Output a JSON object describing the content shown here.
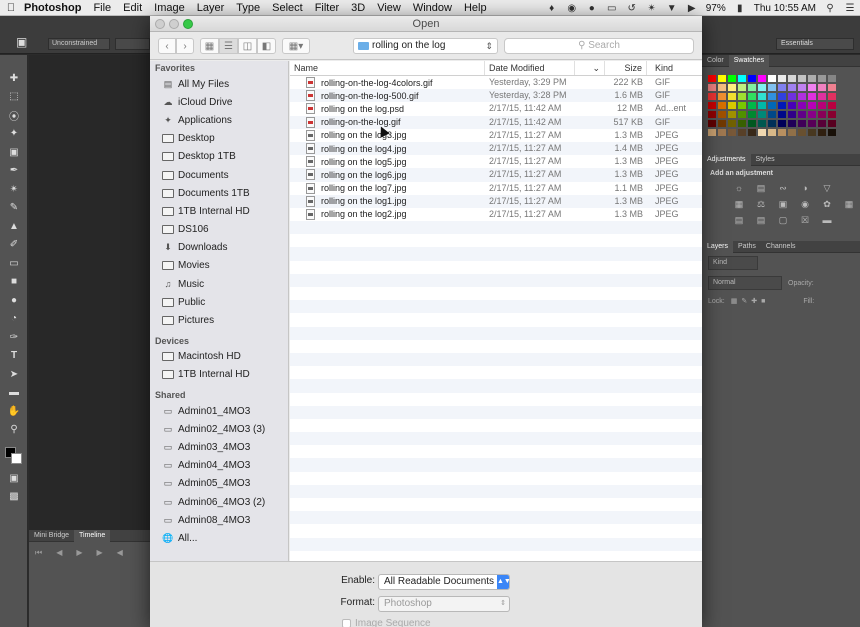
{
  "menubar": {
    "app_name": "Photoshop",
    "menus": [
      "File",
      "Edit",
      "Image",
      "Layer",
      "Type",
      "Select",
      "Filter",
      "3D",
      "View",
      "Window",
      "Help"
    ],
    "battery": "97%",
    "clock": "Thu 10:55 AM"
  },
  "photoshop": {
    "tool_preset": "Unconstrained",
    "workspace": "Essentials",
    "panel_tabs_top": [
      "Color",
      "Swatches"
    ],
    "panel_tabs_mid": [
      "Adjustments",
      "Styles"
    ],
    "adjustment_title": "Add an adjustment",
    "panel_tabs_layers": [
      "Layers",
      "Paths",
      "Channels"
    ],
    "layers_kind": "Kind",
    "layers_blend": "Normal",
    "layers_opacity_label": "Opacity:",
    "layers_lock_label": "Lock:",
    "layers_fill_label": "Fill:",
    "bottom_tabs": [
      "Mini Bridge",
      "Timeline"
    ],
    "swatch_colors": [
      "#ff0000",
      "#ffff00",
      "#00ff00",
      "#00ffff",
      "#0000ff",
      "#ff00ff",
      "#ffffff",
      "#ebebeb",
      "#d6d6d6",
      "#c2c2c2",
      "#adadad",
      "#999999",
      "#858585",
      "#f08080",
      "#f5c080",
      "#fff080",
      "#c0f080",
      "#80f0a0",
      "#80f0f0",
      "#80c0f0",
      "#8080f0",
      "#a080f0",
      "#c080f0",
      "#f080f0",
      "#f080c0",
      "#f08090",
      "#ee3333",
      "#f09030",
      "#f0e030",
      "#a0e030",
      "#30e060",
      "#30e0d0",
      "#3090e0",
      "#3040e0",
      "#7030e0",
      "#b030e0",
      "#e030e0",
      "#e030a0",
      "#e03060",
      "#c80000",
      "#d87000",
      "#d8c800",
      "#78c800",
      "#00b848",
      "#00b8a8",
      "#0068b8",
      "#0018b8",
      "#4800b8",
      "#8800b8",
      "#b800b8",
      "#b80078",
      "#b80040",
      "#900000",
      "#a05000",
      "#a09000",
      "#509000",
      "#008830",
      "#008878",
      "#004888",
      "#000888",
      "#300088",
      "#600088",
      "#880088",
      "#880058",
      "#880030",
      "#600000",
      "#703800",
      "#706000",
      "#386000",
      "#005820",
      "#005850",
      "#003058",
      "#000058",
      "#200058",
      "#400058",
      "#580058",
      "#580038",
      "#580020",
      "#c8a070",
      "#a07850",
      "#785838",
      "#584028",
      "#382818",
      "#f0d8b0",
      "#d8b888",
      "#b89060",
      "#907048",
      "#685030",
      "#483820",
      "#302010",
      "#181008"
    ]
  },
  "dialog": {
    "title": "Open",
    "current_folder": "rolling on the log",
    "search_placeholder": "Search",
    "sidebar": {
      "favorites_heading": "Favorites",
      "favorites": [
        {
          "label": "All My Files",
          "icon": "all-files"
        },
        {
          "label": "iCloud Drive",
          "icon": "cloud"
        },
        {
          "label": "Applications",
          "icon": "applications"
        },
        {
          "label": "Desktop",
          "icon": "folder"
        },
        {
          "label": "Desktop 1TB",
          "icon": "folder"
        },
        {
          "label": "Documents",
          "icon": "folder"
        },
        {
          "label": "Documents 1TB",
          "icon": "folder"
        },
        {
          "label": "1TB Internal HD",
          "icon": "folder"
        },
        {
          "label": "DS106",
          "icon": "folder"
        },
        {
          "label": "Downloads",
          "icon": "download"
        },
        {
          "label": "Movies",
          "icon": "folder"
        },
        {
          "label": "Music",
          "icon": "music"
        },
        {
          "label": "Public",
          "icon": "folder"
        },
        {
          "label": "Pictures",
          "icon": "folder"
        }
      ],
      "devices_heading": "Devices",
      "devices": [
        {
          "label": "Macintosh HD",
          "icon": "drive"
        },
        {
          "label": "1TB Internal HD",
          "icon": "drive"
        }
      ],
      "shared_heading": "Shared",
      "shared": [
        {
          "label": "Admin01_4MO3",
          "icon": "monitor"
        },
        {
          "label": "Admin02_4MO3 (3)",
          "icon": "monitor"
        },
        {
          "label": "Admin03_4MO3",
          "icon": "monitor"
        },
        {
          "label": "Admin04_4MO3",
          "icon": "monitor"
        },
        {
          "label": "Admin05_4MO3",
          "icon": "monitor"
        },
        {
          "label": "Admin06_4MO3 (2)",
          "icon": "monitor"
        },
        {
          "label": "Admin08_4MO3",
          "icon": "monitor"
        },
        {
          "label": "All...",
          "icon": "network"
        }
      ]
    },
    "columns": {
      "name": "Name",
      "date": "Date Modified",
      "size": "Size",
      "kind": "Kind"
    },
    "files": [
      {
        "name": "rolling-on-the-log-4colors.gif",
        "date": "Yesterday, 3:29 PM",
        "size": "222 KB",
        "kind": "GIF",
        "type": "img"
      },
      {
        "name": "rolling-on-the-log-500.gif",
        "date": "Yesterday, 3:28 PM",
        "size": "1.6 MB",
        "kind": "GIF",
        "type": "img"
      },
      {
        "name": "rolling on the log.psd",
        "date": "2/17/15, 11:42 AM",
        "size": "12 MB",
        "kind": "Ad...ent",
        "type": "img"
      },
      {
        "name": "rolling-on-the-log.gif",
        "date": "2/17/15, 11:42 AM",
        "size": "517 KB",
        "kind": "GIF",
        "type": "img"
      },
      {
        "name": "rolling on the log3.jpg",
        "date": "2/17/15, 11:27 AM",
        "size": "1.3 MB",
        "kind": "JPEG",
        "type": "jpg"
      },
      {
        "name": "rolling on the log4.jpg",
        "date": "2/17/15, 11:27 AM",
        "size": "1.4 MB",
        "kind": "JPEG",
        "type": "jpg"
      },
      {
        "name": "rolling on the log5.jpg",
        "date": "2/17/15, 11:27 AM",
        "size": "1.3 MB",
        "kind": "JPEG",
        "type": "jpg"
      },
      {
        "name": "rolling on the log6.jpg",
        "date": "2/17/15, 11:27 AM",
        "size": "1.3 MB",
        "kind": "JPEG",
        "type": "jpg"
      },
      {
        "name": "rolling on the log7.jpg",
        "date": "2/17/15, 11:27 AM",
        "size": "1.1 MB",
        "kind": "JPEG",
        "type": "jpg"
      },
      {
        "name": "rolling on the log1.jpg",
        "date": "2/17/15, 11:27 AM",
        "size": "1.3 MB",
        "kind": "JPEG",
        "type": "jpg"
      },
      {
        "name": "rolling on the log2.jpg",
        "date": "2/17/15, 11:27 AM",
        "size": "1.3 MB",
        "kind": "JPEG",
        "type": "jpg"
      }
    ],
    "enable_label": "Enable:",
    "enable_value": "All Readable Documents",
    "format_label": "Format:",
    "format_value": "Photoshop",
    "image_sequence_label": "Image Sequence"
  }
}
